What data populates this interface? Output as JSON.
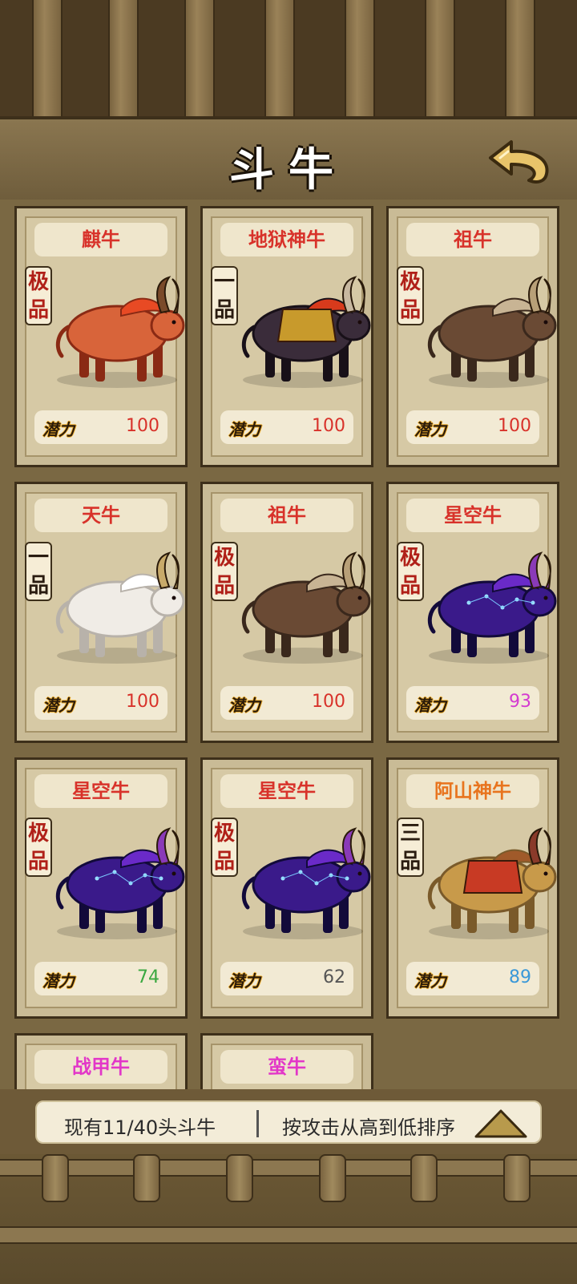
{
  "header": {
    "title": "斗牛"
  },
  "potential_label": "潜力",
  "cards": [
    {
      "name": "麒牛",
      "grade": "极品",
      "potential": "100",
      "name_color": "red",
      "potential_color": "#d8322a",
      "beast": "qilin-bull"
    },
    {
      "name": "地狱神牛",
      "grade": "一品",
      "potential": "100",
      "name_color": "red",
      "potential_color": "#d8322a",
      "beast": "hell-bull"
    },
    {
      "name": "祖牛",
      "grade": "极品",
      "potential": "100",
      "name_color": "red",
      "potential_color": "#d8322a",
      "beast": "ancestor-bull"
    },
    {
      "name": "天牛",
      "grade": "一品",
      "potential": "100",
      "name_color": "red",
      "potential_color": "#d8322a",
      "beast": "heaven-bull"
    },
    {
      "name": "祖牛",
      "grade": "极品",
      "potential": "100",
      "name_color": "red",
      "potential_color": "#d8322a",
      "beast": "ancestor-bull"
    },
    {
      "name": "星空牛",
      "grade": "极品",
      "potential": "93",
      "name_color": "red",
      "potential_color": "#d43ad0",
      "beast": "starry-bull"
    },
    {
      "name": "星空牛",
      "grade": "极品",
      "potential": "74",
      "name_color": "red",
      "potential_color": "#3aa840",
      "beast": "starry-bull"
    },
    {
      "name": "星空牛",
      "grade": "极品",
      "potential": "62",
      "name_color": "red",
      "potential_color": "#555555",
      "beast": "starry-bull"
    },
    {
      "name": "阿山神牛",
      "grade": "三品",
      "potential": "89",
      "name_color": "orange",
      "potential_color": "#3a98d8",
      "beast": "ashan-bull"
    },
    {
      "name": "战甲牛",
      "grade": "",
      "potential": "",
      "name_color": "pink",
      "potential_color": "#555555",
      "beast": ""
    },
    {
      "name": "蛮牛",
      "grade": "",
      "potential": "",
      "name_color": "pink",
      "potential_color": "#555555",
      "beast": ""
    }
  ],
  "footer": {
    "count_text": "现有11/40头斗牛",
    "sort_text": "按攻击从高到低排序"
  }
}
